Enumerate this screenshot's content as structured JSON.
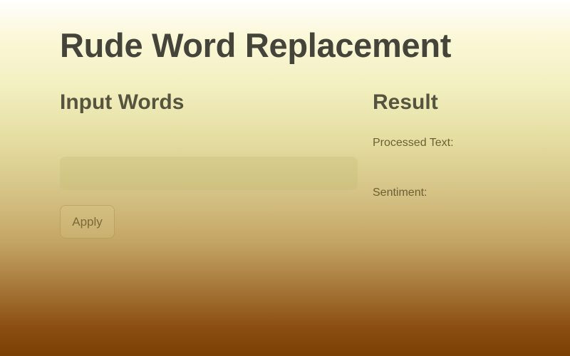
{
  "page": {
    "title": "Rude Word Replacement"
  },
  "input_section": {
    "heading": "Input Words",
    "input_value": "",
    "input_placeholder": "",
    "apply_label": "Apply"
  },
  "result_section": {
    "heading": "Result",
    "processed_label": "Processed Text:",
    "processed_value": "",
    "sentiment_label": "Sentiment:",
    "sentiment_value": ""
  },
  "colors": {
    "title_text": "#44443a",
    "gradient_top": "#ffffff",
    "gradient_bottom": "#7a3f04"
  }
}
